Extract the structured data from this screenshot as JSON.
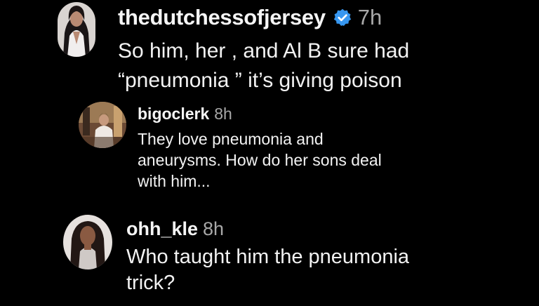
{
  "comments": [
    {
      "username": "thedutchessofjersey",
      "time": "7h",
      "verified": true,
      "text": "So him, her , and Al B sure had\n“pneumonia ” it’s giving poison"
    },
    {
      "username": "bigoclerk",
      "time": "8h",
      "text": "They love pneumonia and\naneurysms. How do her sons deal\nwith him..."
    },
    {
      "username": "ohh_kle",
      "time": "8h",
      "text": "Who taught him the pneumonia\ntrick?"
    }
  ],
  "colors": {
    "background": "#000000",
    "text": "#f2f2f2",
    "timestamp": "#a8a8a8",
    "verified_badge": "#3797f0"
  },
  "icons": {
    "verified": "verified-badge-icon"
  }
}
